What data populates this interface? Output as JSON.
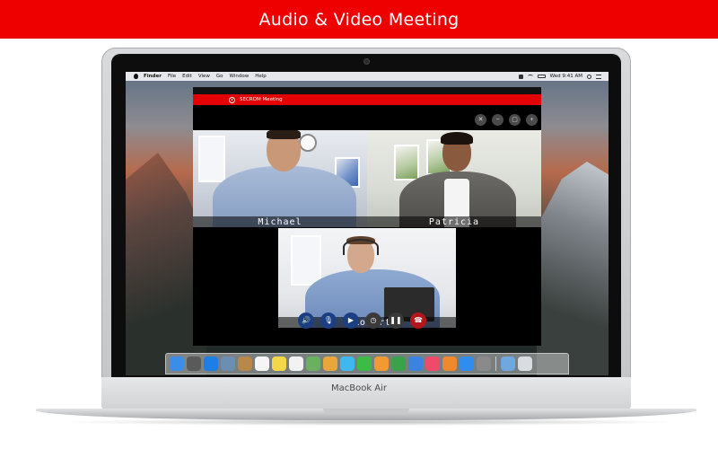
{
  "banner": {
    "title": "Audio & Video Meeting"
  },
  "laptop": {
    "brand": "MacBook Air"
  },
  "menubar": {
    "app": "Finder",
    "items": [
      "File",
      "Edit",
      "View",
      "Go",
      "Window",
      "Help"
    ],
    "clock": "Wed 9:41 AM"
  },
  "app": {
    "title": "SECROM Meeting",
    "toolbar": [
      {
        "icon": "close-icon",
        "glyph": "✕"
      },
      {
        "icon": "minus-icon",
        "glyph": "−"
      },
      {
        "icon": "fullscreen-icon",
        "glyph": "▢"
      },
      {
        "icon": "plus-icon",
        "glyph": "+"
      }
    ],
    "participants": [
      "Michael",
      "Patricia",
      "Robert"
    ],
    "controls": [
      {
        "icon": "speaker-icon",
        "glyph": "🔊"
      },
      {
        "icon": "microphone-icon",
        "glyph": "🎙"
      },
      {
        "icon": "camera-icon",
        "glyph": "▶"
      },
      {
        "icon": "screen-share-icon",
        "glyph": "◷"
      },
      {
        "icon": "pause-icon",
        "glyph": "❚❚"
      },
      {
        "icon": "hang-up-icon",
        "glyph": "☎"
      }
    ]
  },
  "dock": {
    "apps": [
      {
        "name": "finder-dock-icon",
        "color": "#3b8ee8"
      },
      {
        "name": "launchpad-dock-icon",
        "color": "#5a5a5a"
      },
      {
        "name": "safari-dock-icon",
        "color": "#1d7ee6"
      },
      {
        "name": "mail-dock-icon",
        "color": "#6b8fb0"
      },
      {
        "name": "contacts-dock-icon",
        "color": "#b8884a"
      },
      {
        "name": "calendar-dock-icon",
        "color": "#f5f5f5"
      },
      {
        "name": "notes-dock-icon",
        "color": "#f4d64b"
      },
      {
        "name": "reminders-dock-icon",
        "color": "#f2f2f2"
      },
      {
        "name": "maps-dock-icon",
        "color": "#6bb060"
      },
      {
        "name": "photos-dock-icon",
        "color": "#e9a63b"
      },
      {
        "name": "messages-dock-icon",
        "color": "#3fb8f0"
      },
      {
        "name": "facetime-dock-icon",
        "color": "#3bbd45"
      },
      {
        "name": "pages-dock-icon",
        "color": "#f29a32"
      },
      {
        "name": "numbers-dock-icon",
        "color": "#3aa34a"
      },
      {
        "name": "keynote-dock-icon",
        "color": "#3b83e0"
      },
      {
        "name": "music-dock-icon",
        "color": "#f04a6a"
      },
      {
        "name": "books-dock-icon",
        "color": "#f0892b"
      },
      {
        "name": "app-store-dock-icon",
        "color": "#2f8df0"
      },
      {
        "name": "system-preferences-dock-icon",
        "color": "#8a8a8a"
      },
      {
        "name": "downloads-dock-icon",
        "color": "#6fa7e0"
      },
      {
        "name": "trash-dock-icon",
        "color": "#d9dde2"
      }
    ]
  },
  "colors": {
    "accent": "#ee0000"
  }
}
